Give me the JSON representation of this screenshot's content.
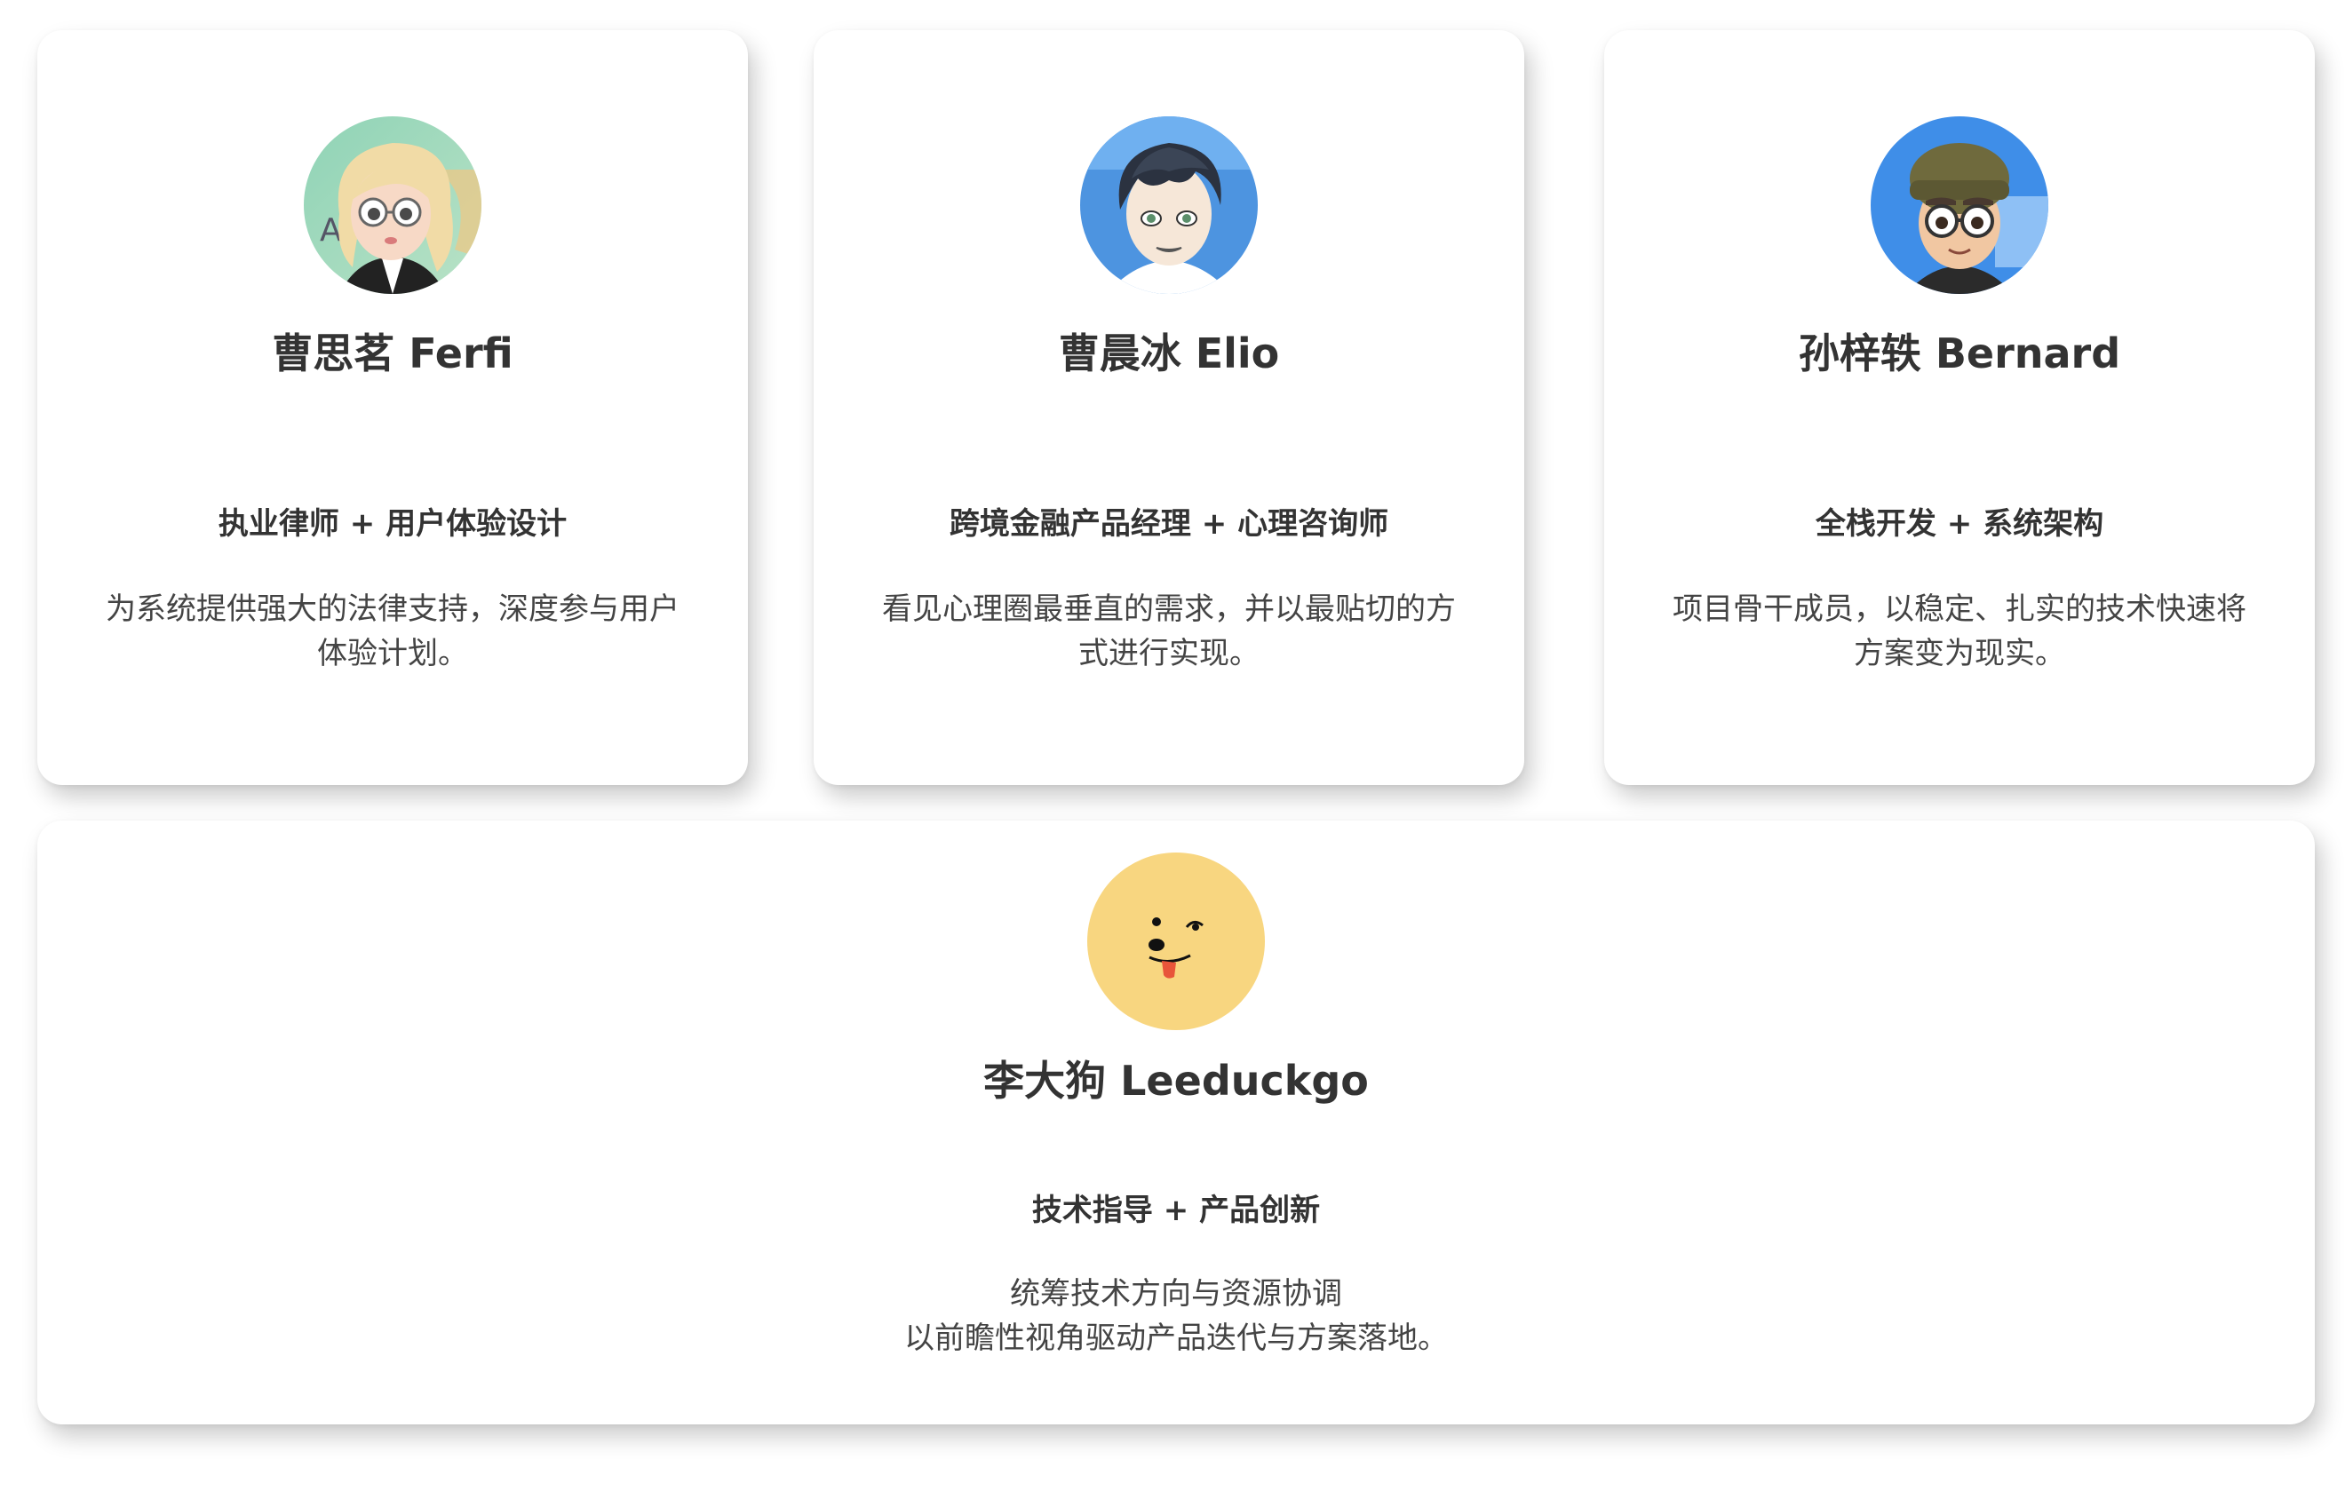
{
  "members": [
    {
      "name": "曹思茗 Ferfi",
      "role": "执业律师 + 用户体验设计",
      "desc_lines": [
        "为系统提供强大的法律支持，深度参与用户",
        "体验计划。"
      ],
      "avatar": "girl-avatar-icon"
    },
    {
      "name": "曹晨冰 Elio",
      "role": "跨境金融产品经理 + 心理咨询师",
      "desc_lines": [
        "看见心理圈最垂直的需求，并以最贴切的方",
        "式进行实现。"
      ],
      "avatar": "anime-boy-avatar-icon"
    },
    {
      "name": "孙梓轶 Bernard",
      "role": "全栈开发 + 系统架构",
      "desc_lines": [
        "项目骨干成员，以稳定、扎实的技术快速将",
        "方案变为现实。"
      ],
      "avatar": "beanie-boy-avatar-icon"
    },
    {
      "name": "李大狗 Leeduckgo",
      "role": "技术指导 + 产品创新",
      "desc_lines": [
        "统筹技术方向与资源协调",
        "以前瞻性视角驱动产品迭代与方案落地。"
      ],
      "avatar": "doge-avatar-icon"
    }
  ],
  "colors": {
    "card_bg": "#ffffff",
    "text": "#333333",
    "doge_bg": "#f8d680"
  }
}
